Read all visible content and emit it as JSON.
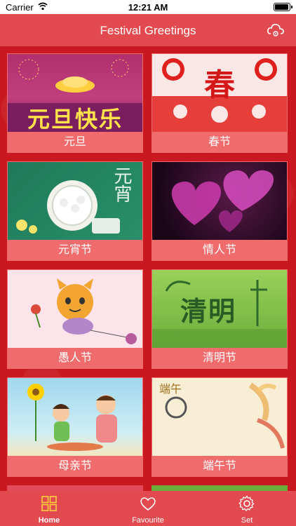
{
  "status_bar": {
    "carrier": "Carrier",
    "time": "12:21 AM"
  },
  "nav": {
    "title": "Festival Greetings",
    "action_icon": "cloud-settings-icon"
  },
  "grid": {
    "cards": [
      {
        "label": "元旦",
        "banner_text": "元旦快乐"
      },
      {
        "label": "春节",
        "banner_text": "春"
      },
      {
        "label": "元宵节",
        "banner_text": "元宵"
      },
      {
        "label": "情人节",
        "banner_text": ""
      },
      {
        "label": "愚人节",
        "banner_text": ""
      },
      {
        "label": "清明节",
        "banner_text": "清明"
      },
      {
        "label": "母亲节",
        "banner_text": ""
      },
      {
        "label": "端午节",
        "banner_text": "端午"
      }
    ]
  },
  "tabbar": {
    "tabs": [
      {
        "label": "Home",
        "icon": "grid-icon",
        "active": true
      },
      {
        "label": "Favourite",
        "icon": "heart-icon",
        "active": false
      },
      {
        "label": "Set",
        "icon": "gear-icon",
        "active": false
      }
    ]
  },
  "colors": {
    "primary": "#e34a4f",
    "background": "#c91820",
    "card": "#f06b6b"
  }
}
